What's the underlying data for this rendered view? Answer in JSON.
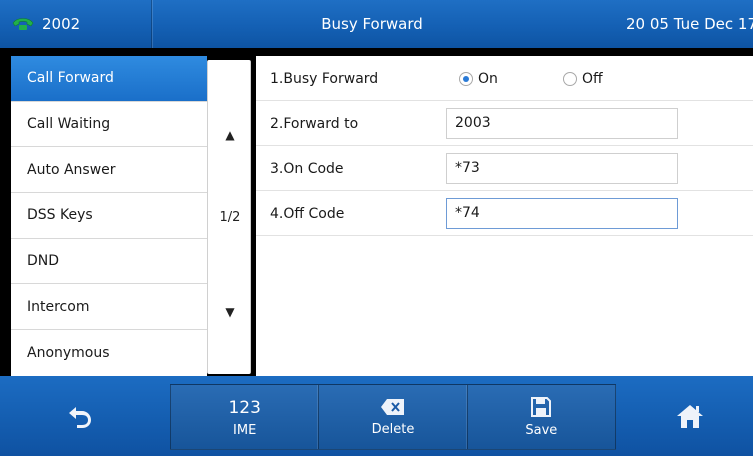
{
  "status_bar": {
    "line_number": "2002",
    "title": "Busy Forward",
    "clock": "20 05 Tue Dec 17"
  },
  "menu": {
    "items": [
      {
        "label": "Call Forward",
        "active": true
      },
      {
        "label": "Call Waiting"
      },
      {
        "label": "Auto Answer"
      },
      {
        "label": "DSS Keys"
      },
      {
        "label": "DND"
      },
      {
        "label": "Intercom"
      },
      {
        "label": "Anonymous"
      }
    ]
  },
  "pager": {
    "page": "1/2",
    "up_arrow": "▲",
    "down_arrow": "▼"
  },
  "settings": {
    "busy_forward": {
      "label": "1.Busy Forward",
      "option_on": "On",
      "option_off": "Off",
      "selected": "On"
    },
    "forward_to": {
      "label": "2.Forward to",
      "value": "2003"
    },
    "on_code": {
      "label": "3.On Code",
      "value": "*73"
    },
    "off_code": {
      "label": "4.Off Code",
      "value": "*74"
    }
  },
  "softkeys": {
    "back_icon": "back-arrow-icon",
    "ime": {
      "top": "123",
      "label": "IME"
    },
    "delete": {
      "icon": "backspace-icon",
      "label": "Delete"
    },
    "save": {
      "icon": "floppy-disk-icon",
      "label": "Save"
    },
    "home_icon": "home-icon"
  },
  "colors": {
    "bar_blue": "#1460b4",
    "active_menu": "#1f7ad3",
    "radio_selected": "#2a7ad6",
    "phone_icon": "#21b04b"
  }
}
